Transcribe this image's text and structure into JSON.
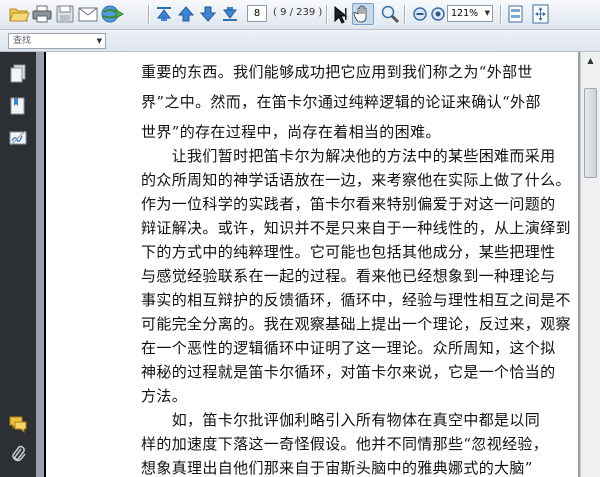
{
  "toolbar": {
    "page_current": "8",
    "page_count": "( 9 / 239 )",
    "zoom": "121%",
    "icons": [
      "open-folder-icon",
      "print-icon",
      "save-icon",
      "email-icon",
      "web-globe-icon",
      "first-page-icon",
      "previous-page-icon",
      "next-page-icon",
      "last-page-icon",
      "select-text-icon",
      "hand-tool-icon",
      "zoom-tool-icon",
      "zoom-out-icon",
      "zoom-in-icon",
      "single-page-icon",
      "fit-page-icon"
    ]
  },
  "findbar": {
    "placeholder": "查找"
  },
  "leftpanel": {
    "icons": [
      "pages-icon",
      "bookmarks-icon",
      "signatures-icon",
      "comments-icon",
      "attachments-icon"
    ]
  },
  "document": {
    "lines": [
      "重要的东西。我们能够成功把它应用到我们称之为“外部世",
      "界”之中。然而，在笛卡尔通过纯粹逻辑的论证来确认“外部",
      "世界”的存在过程中，尚存在着相当的困难。",
      "　　让我们暂时把笛卡尔为解决他的方法中的某些困难而采用",
      "的众所周知的神学话语放在一边，来考察他在实际上做了什么。",
      "作为一位科学的实践者，笛卡尔看来特别偏爱于对这一问题的",
      "辩证解决。或许，知识并不是只来自于一种线性的，从上演绎到",
      "下的方式中的纯粹理性。它可能也包括其他成分，某些把理性",
      "与感觉经验联系在一起的过程。看来他已经想象到一种理论与",
      "事实的相互辩护的反馈循环，循环中，经验与理性相互之间是不",
      "可能完全分离的。我在观察基础上提出一个理论，反过来，观察",
      "在一个恶性的逻辑循环中证明了这一理论。众所周知，这个拟",
      "神秘的过程就是笛卡尔循环，对笛卡尔来说，它是一个恰当的",
      "方法。",
      "　　如，笛卡尔批评伽利略引入所有物体在真空中都是以同",
      "样的加速度下落这一奇怪假设。他并不同情那些“忽视经验，",
      "想象真理出自他们那来自于宙斯头脑中的雅典娜式的大脑”"
    ]
  }
}
